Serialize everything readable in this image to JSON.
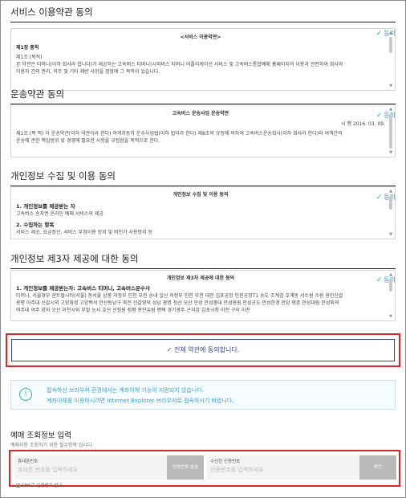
{
  "sections": {
    "service": {
      "title": "서비스 이용약관 동의",
      "agree": "동의",
      "doc_title": "<서비스 이용약관>",
      "chapter": "제1장 총칙",
      "article": "제1조 (목적)",
      "line1": "본 약관은 티머니(이하 회사라 합니다)가 제공하는 고속버스 티머니(시외버스 티머니 어플리케이션 서비스 및 고속버스통합예매 홈페이지의 이용과 관련하여 회사와",
      "line2": "이용자 간의 권리, 의무 및 기타 제반 사항을 정함에 그 목적이 있습니다."
    },
    "transport": {
      "title": "운송약관 동의",
      "agree": "동의",
      "doc_title": "고속버스 운송사업 운송약관",
      "date": "시 행 2016. 03. 09.",
      "line1": "제1조 (목 적) 이 운송약관(이하 약관이라 한다) 여객자동차 운수사업법(이하 법이라 한다) 제8조의 규정에 의하여 고속버스운송회사(이하 회사라 한다)와 여객간의",
      "line2": "운송에 관한 책임범위 및 경영에 필요한 사항을 규정함을 목적으로 한다."
    },
    "privacy": {
      "title": "개인정보 수집 및 이용 동의",
      "agree": "동의",
      "doc_title": "개인정보 수집 및 이용 동의",
      "h1": "1. 개인정보를 제공받는 자",
      "p1": "고속버스 승차권 온라인 예매 서비스의 제공",
      "h2": "2. 수집하는 항목",
      "p2": "서비스 제공, 요금정산, 서비스 부정이용 방지 및 비인가 사용방지 등"
    },
    "third": {
      "title": "개인정보 제3자 제공에 대한 동의",
      "agree": "동의",
      "doc_title": "개인정보 제3자 제공에 대한 동의",
      "h1": "1. 개인정보를 제공받는자: 고속버스 티머니, 고속버스운수사",
      "line1": "티머니, 서울경부 센트럴시티(서울) 동서울 상봉 의정부 인천 부천 송내 일산 의정부 인천 부천 대전 김포공항 인천공항T1 송도 조계검 호계동 서수원 수원 용인신갈",
      "line2": "용평 아주대 신갈시외 고양화정 고양백석 안산동남구 죽전 신갈영덕 성남 광명 청산 오산 안성 안성중대 안성용원 안성공도 안성한경 안양 평촌 안성대림 안성외곽",
      "line3": "여주대 여주 양지 오산 이천시외 부발 능서 호산 신정원 점평 용인유림 평택 경기광주 곤지암 김포시청 이천 구리 이천"
    }
  },
  "agree_all": "✓ 전체 약관에 동의합니다.",
  "notice": {
    "icon": "!",
    "line1": "접속하신 브라우저 환경에서는 계좌이체 기능이 지원되지 않습니다.",
    "line2": "계좌이체를 이용하시려면 Internet Explorer 브라우저로 접속하시기 바랍니다."
  },
  "reservation": {
    "title": "예매 조회정보 입력",
    "subtitle": "예매사항 조회하기 위한 필수항목 입니다.",
    "phone_label": "휴대폰번호",
    "phone_placeholder": "휴대폰 번호를 입력하세요",
    "send_button": "인증번호 발송",
    "code_label": "수신한 인증번호",
    "code_placeholder": "인증번호를 입력하세요",
    "confirm_button": "확인",
    "sms_label": "SMS로 인증번호 받기"
  },
  "colors": {
    "accent": "#3aa3c9",
    "agree_all_text": "#3b3f8f",
    "highlight": "#d9262b"
  }
}
